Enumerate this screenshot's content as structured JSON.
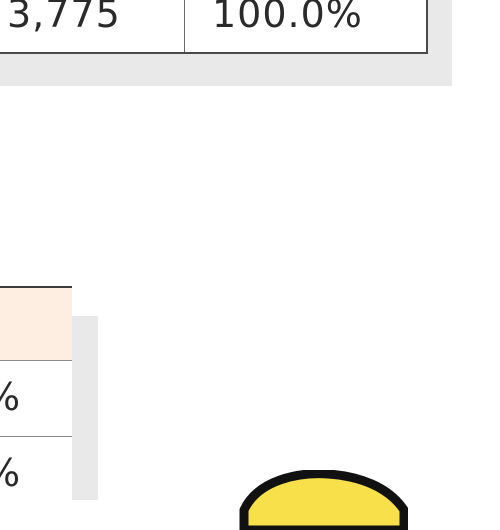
{
  "summary_table": {
    "total_label": "3,775",
    "percent_label": "100.0%"
  },
  "breakdown_table": {
    "rows": [
      {
        "percent_suffix": "%"
      },
      {
        "percent_suffix": "%"
      }
    ]
  },
  "colors": {
    "header_fill": "#fdeee1",
    "panel_shadow": "#e9e9ea",
    "mascot_fill": "#f7e04a"
  }
}
